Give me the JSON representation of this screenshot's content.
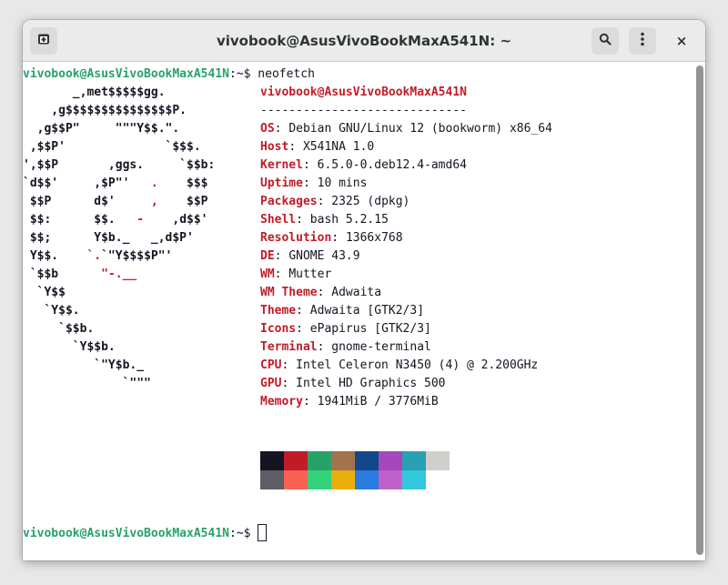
{
  "window": {
    "title": "vivobook@AsusVivoBookMaxA541N: ~",
    "new_tab_icon": "terminal-new-tab-icon",
    "search_icon": "search-icon",
    "menu_icon": "kebab-menu-icon",
    "close_label": "×"
  },
  "prompt": {
    "user_host": "vivobook@AsusVivoBookMaxA541N",
    "sep": ":",
    "path": "~",
    "symbol": "$ ",
    "command": "neofetch"
  },
  "logo": [
    {
      "segs": [
        {
          "t": "       _,met$$$$$gg.",
          "c": ""
        }
      ]
    },
    {
      "segs": [
        {
          "t": "    ,g$$$$$$$$$$$$$$$P.",
          "c": ""
        }
      ]
    },
    {
      "segs": [
        {
          "t": "  ,g$$P\"     \"\"\"Y$$.\".",
          "c": ""
        }
      ]
    },
    {
      "segs": [
        {
          "t": " ,$$P'              `$$$.",
          "c": ""
        }
      ]
    },
    {
      "segs": [
        {
          "t": "',$$P       ,ggs.     `$$b:",
          "c": ""
        }
      ]
    },
    {
      "segs": [
        {
          "t": "`d$$'     ,$P\"'   ",
          "c": ""
        },
        {
          "t": ".",
          "c": "red"
        },
        {
          "t": "    $$$",
          "c": ""
        }
      ]
    },
    {
      "segs": [
        {
          "t": " $$P      d$'     ",
          "c": ""
        },
        {
          "t": ",",
          "c": "red"
        },
        {
          "t": "    $$P",
          "c": ""
        }
      ]
    },
    {
      "segs": [
        {
          "t": " $$:      $$.   ",
          "c": ""
        },
        {
          "t": "-",
          "c": "red"
        },
        {
          "t": "    ,d$$'",
          "c": ""
        }
      ]
    },
    {
      "segs": [
        {
          "t": " $$;      Y$b._   _,d$P'",
          "c": ""
        }
      ]
    },
    {
      "segs": [
        {
          "t": " Y$$.    ",
          "c": ""
        },
        {
          "t": "`.",
          "c": "red"
        },
        {
          "t": "`\"Y$$$$P\"'",
          "c": ""
        }
      ]
    },
    {
      "segs": [
        {
          "t": " `$$b      ",
          "c": ""
        },
        {
          "t": "\"-.__",
          "c": "red"
        }
      ]
    },
    {
      "segs": [
        {
          "t": "  `Y$$",
          "c": ""
        }
      ]
    },
    {
      "segs": [
        {
          "t": "   `Y$$.",
          "c": ""
        }
      ]
    },
    {
      "segs": [
        {
          "t": "     `$$b.",
          "c": ""
        }
      ]
    },
    {
      "segs": [
        {
          "t": "       `Y$$b.",
          "c": ""
        }
      ]
    },
    {
      "segs": [
        {
          "t": "          `\"Y$b._",
          "c": ""
        }
      ]
    },
    {
      "segs": [
        {
          "t": "              `\"\"\"",
          "c": ""
        }
      ]
    }
  ],
  "header": {
    "user": "vivobook",
    "at": "@",
    "host": "AsusVivoBookMaxA541N",
    "rule": "-----------------------------"
  },
  "info": [
    {
      "key": "OS",
      "value": "Debian GNU/Linux 12 (bookworm) x86_64"
    },
    {
      "key": "Host",
      "value": "X541NA 1.0"
    },
    {
      "key": "Kernel",
      "value": "6.5.0-0.deb12.4-amd64"
    },
    {
      "key": "Uptime",
      "value": "10 mins"
    },
    {
      "key": "Packages",
      "value": "2325 (dpkg)"
    },
    {
      "key": "Shell",
      "value": "bash 5.2.15"
    },
    {
      "key": "Resolution",
      "value": "1366x768"
    },
    {
      "key": "DE",
      "value": "GNOME 43.9"
    },
    {
      "key": "WM",
      "value": "Mutter"
    },
    {
      "key": "WM Theme",
      "value": "Adwaita"
    },
    {
      "key": "Theme",
      "value": "Adwaita [GTK2/3]"
    },
    {
      "key": "Icons",
      "value": "ePapirus [GTK2/3]"
    },
    {
      "key": "Terminal",
      "value": "gnome-terminal"
    },
    {
      "key": "CPU",
      "value": "Intel Celeron N3450 (4) @ 2.200GHz"
    },
    {
      "key": "GPU",
      "value": "Intel HD Graphics 500"
    },
    {
      "key": "Memory",
      "value": "1941MiB / 3776MiB"
    }
  ],
  "key_sep": ": ",
  "palette": {
    "normal": [
      "#171421",
      "#c01c28",
      "#26a269",
      "#a2734c",
      "#12488b",
      "#a347ba",
      "#2aa1b3",
      "#d0cfcc"
    ],
    "bright": [
      "#5e5c64",
      "#f66151",
      "#33d17a",
      "#e9ad0c",
      "#2a7bde",
      "#c061cb",
      "#33c7de",
      "#ffffff"
    ]
  }
}
